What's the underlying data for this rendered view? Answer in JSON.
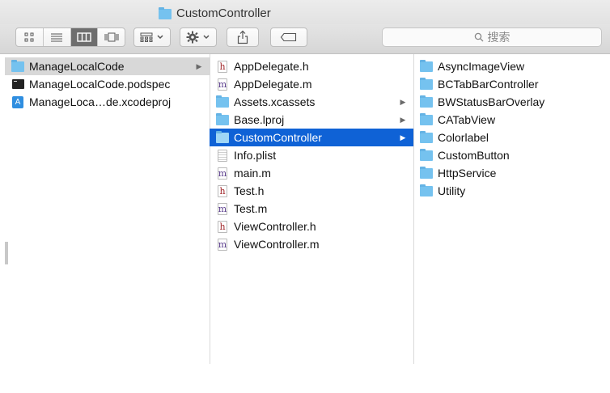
{
  "window": {
    "title": "CustomController"
  },
  "toolbar": {
    "view_buttons": [
      {
        "name": "icon-view",
        "icon": "grid-icon"
      },
      {
        "name": "list-view",
        "icon": "list-icon"
      },
      {
        "name": "column-view",
        "icon": "columns-icon",
        "active": true
      },
      {
        "name": "coverflow-view",
        "icon": "coverflow-icon"
      }
    ],
    "search_placeholder": "搜索"
  },
  "columns": [
    {
      "items": [
        {
          "label": "ManageLocalCode",
          "icon": "folder",
          "arrow": true,
          "selected": "inactive"
        },
        {
          "label": "ManageLocalCode.podspec",
          "icon": "terminal"
        },
        {
          "label": "ManageLoca…de.xcodeproj",
          "icon": "xcodeproj"
        }
      ]
    },
    {
      "items": [
        {
          "label": "AppDelegate.h",
          "icon": "h"
        },
        {
          "label": "AppDelegate.m",
          "icon": "m"
        },
        {
          "label": "Assets.xcassets",
          "icon": "folder",
          "arrow": true
        },
        {
          "label": "Base.lproj",
          "icon": "folder",
          "arrow": true
        },
        {
          "label": "CustomController",
          "icon": "folder",
          "arrow": true,
          "selected": "active"
        },
        {
          "label": "Info.plist",
          "icon": "plist"
        },
        {
          "label": "main.m",
          "icon": "m"
        },
        {
          "label": "Test.h",
          "icon": "h"
        },
        {
          "label": "Test.m",
          "icon": "m"
        },
        {
          "label": "ViewController.h",
          "icon": "h"
        },
        {
          "label": "ViewController.m",
          "icon": "m"
        }
      ]
    },
    {
      "items": [
        {
          "label": "AsyncImageView",
          "icon": "folder"
        },
        {
          "label": "BCTabBarController",
          "icon": "folder"
        },
        {
          "label": "BWStatusBarOverlay",
          "icon": "folder"
        },
        {
          "label": "CATabView",
          "icon": "folder"
        },
        {
          "label": "Colorlabel",
          "icon": "folder"
        },
        {
          "label": "CustomButton",
          "icon": "folder"
        },
        {
          "label": "HttpService",
          "icon": "folder"
        },
        {
          "label": "Utility",
          "icon": "folder"
        }
      ]
    }
  ],
  "colors": {
    "selection_active": "#0f62d6",
    "selection_inactive": "#d8d8d8",
    "folder": "#75c2ef"
  }
}
